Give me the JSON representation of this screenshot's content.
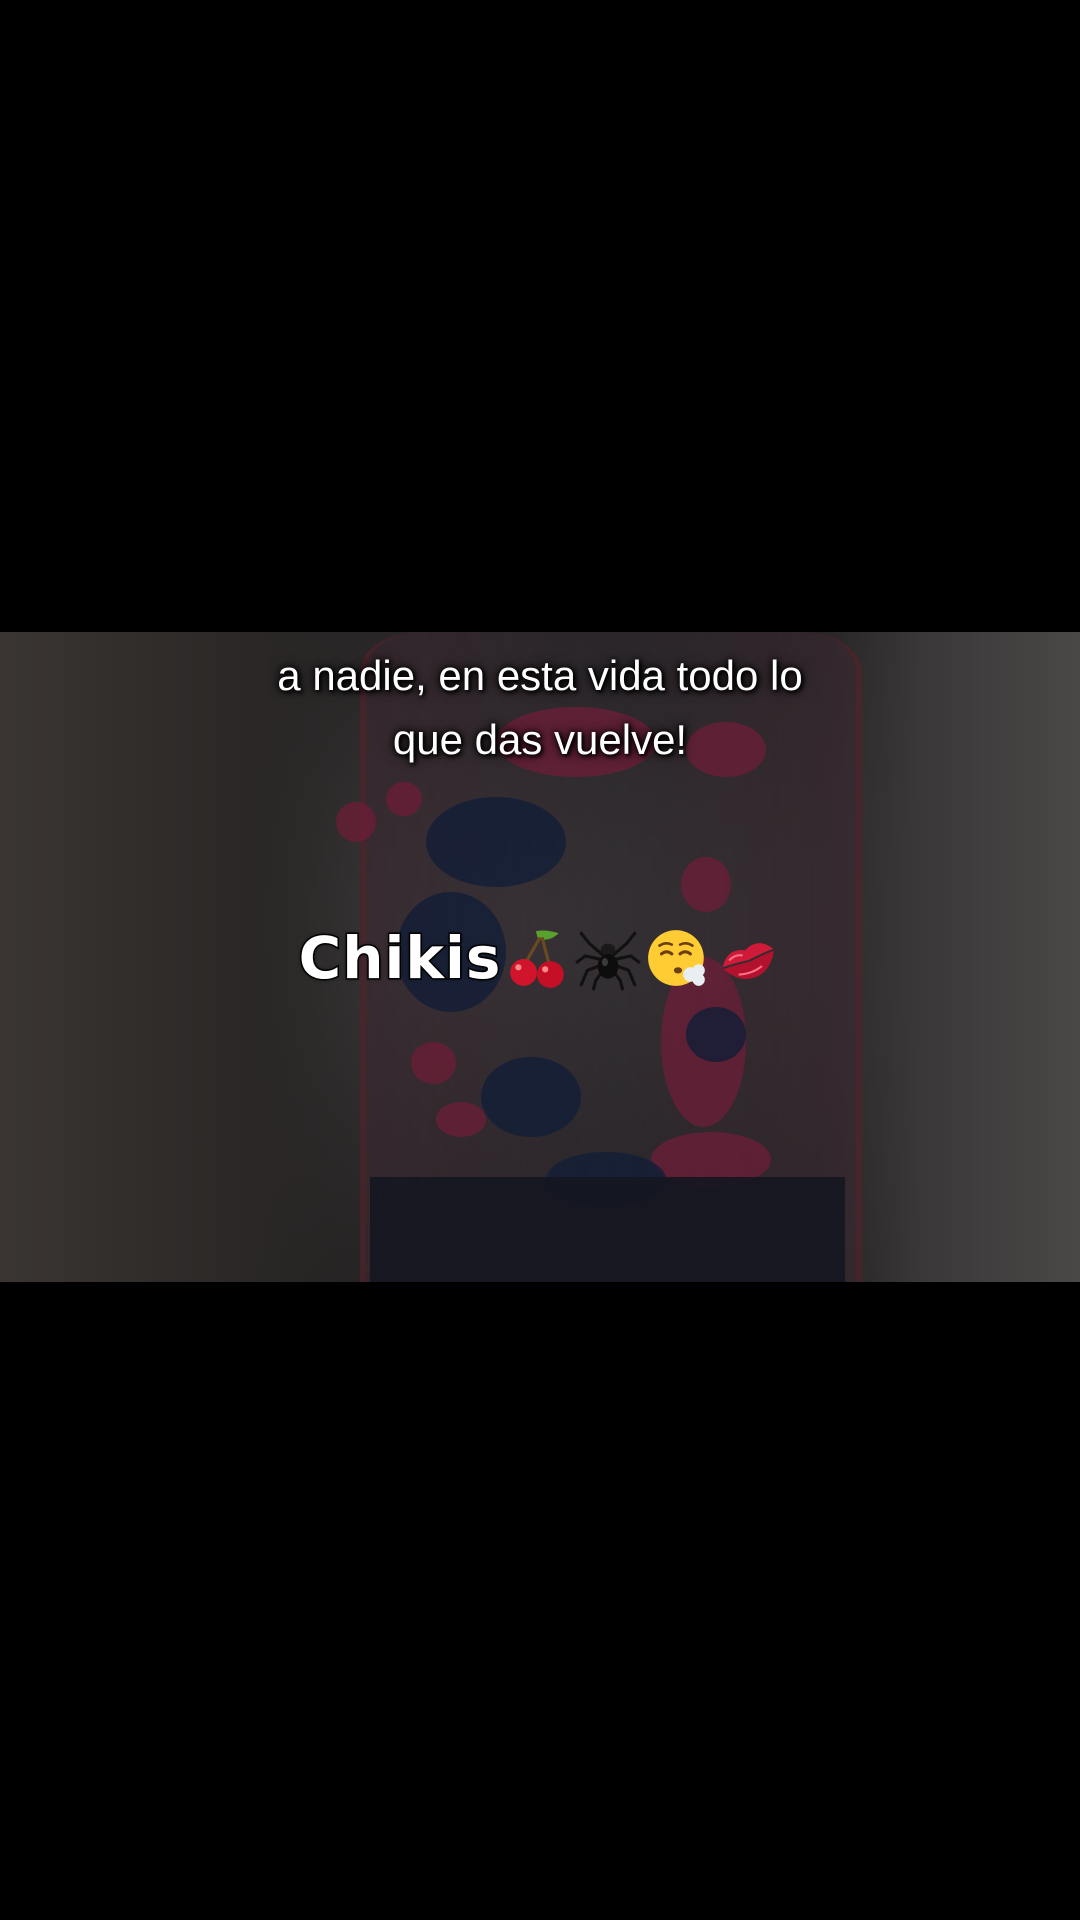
{
  "caption": {
    "line1": "a nadie, en esta vida todo lo",
    "line2": "que das vuelve!"
  },
  "tag": {
    "name": "Chikis",
    "emojis": [
      "cherries-icon",
      "spider-icon",
      "face-exhaling-icon",
      "kiss-mark-icon"
    ]
  },
  "colors": {
    "background": "#000000",
    "caption_text": "#ffffff",
    "red_blob": "#6e1e37",
    "blue_blob": "#141e37"
  }
}
